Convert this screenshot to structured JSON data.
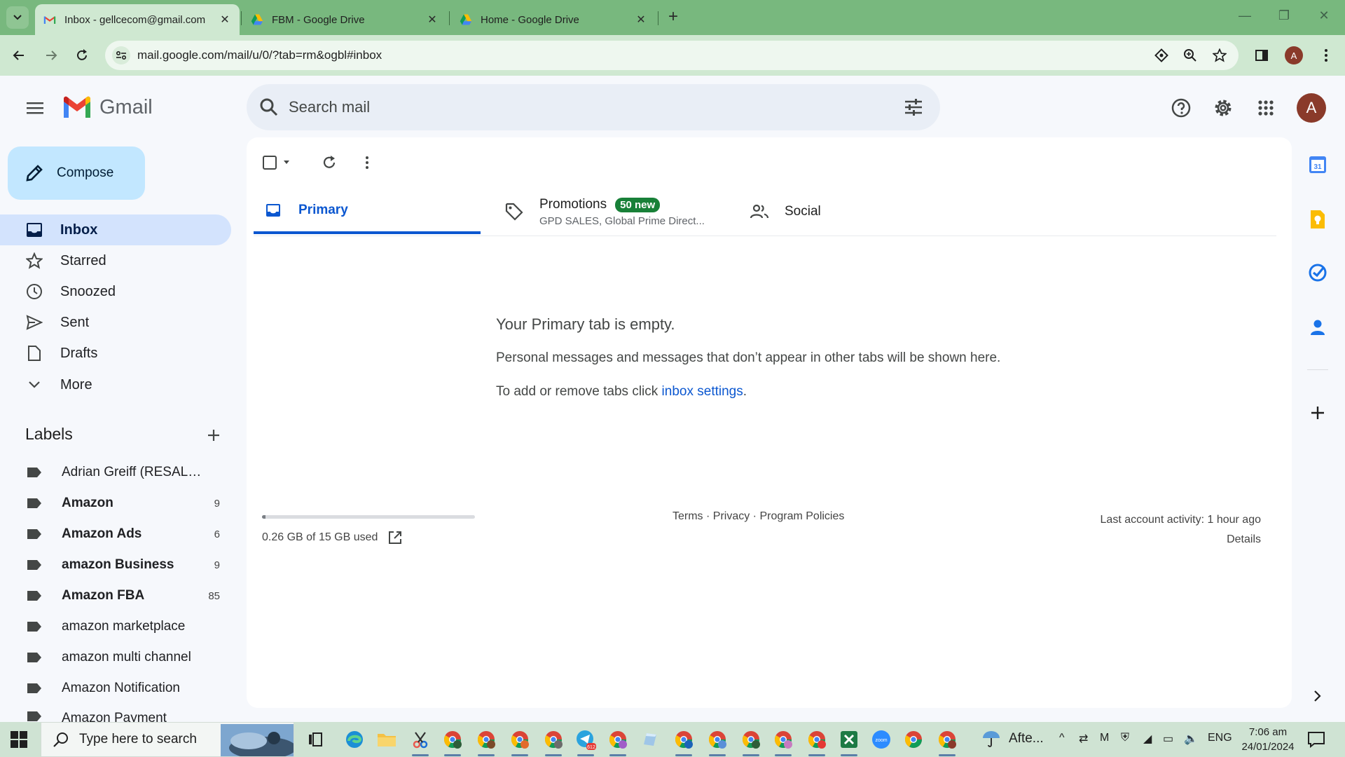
{
  "browser": {
    "tabs": [
      {
        "title": "Inbox - gellcecom@gmail.com",
        "active": true,
        "favicon": "gmail-icon"
      },
      {
        "title": "FBM - Google Drive",
        "active": false,
        "favicon": "drive-icon"
      },
      {
        "title": "Home - Google Drive",
        "active": false,
        "favicon": "drive-icon"
      }
    ],
    "url": "mail.google.com/mail/u/0/?tab=rm&ogbl#inbox",
    "profile_initial": "A"
  },
  "app": {
    "name": "Gmail",
    "search_placeholder": "Search mail",
    "avatar_initial": "A"
  },
  "compose_label": "Compose",
  "nav": [
    {
      "label": "Inbox",
      "icon": "inbox-icon",
      "active": true
    },
    {
      "label": "Starred",
      "icon": "star-icon"
    },
    {
      "label": "Snoozed",
      "icon": "clock-icon"
    },
    {
      "label": "Sent",
      "icon": "send-icon"
    },
    {
      "label": "Drafts",
      "icon": "draft-icon"
    },
    {
      "label": "More",
      "icon": "chevron-down-icon"
    }
  ],
  "labels_title": "Labels",
  "labels": [
    {
      "name": "Adrian Greiff (RESALE C...",
      "count": "",
      "bold": false
    },
    {
      "name": "Amazon",
      "count": "9",
      "bold": true
    },
    {
      "name": "Amazon Ads",
      "count": "6",
      "bold": true
    },
    {
      "name": "amazon Business",
      "count": "9",
      "bold": true
    },
    {
      "name": "Amazon FBA",
      "count": "85",
      "bold": true
    },
    {
      "name": "amazon marketplace",
      "count": "",
      "bold": false
    },
    {
      "name": "amazon multi channel",
      "count": "",
      "bold": false
    },
    {
      "name": "Amazon Notification",
      "count": "",
      "bold": false
    },
    {
      "name": "Amazon Payment",
      "count": "",
      "bold": false
    }
  ],
  "categories": {
    "primary": "Primary",
    "promotions": {
      "title": "Promotions",
      "badge": "50 new",
      "snippet": "GPD SALES, Global Prime Direct..."
    },
    "social": "Social"
  },
  "empty_state": {
    "title": "Your Primary tab is empty.",
    "line1": "Personal messages and messages that don’t appear in other tabs will be shown here.",
    "line2_prefix": "To add or remove tabs click ",
    "line2_link": "inbox settings",
    "line2_suffix": "."
  },
  "footer": {
    "storage_text": "0.26 GB of 15 GB used",
    "storage_fraction": 0.017,
    "links": "Terms · Privacy · Program Policies",
    "activity": "Last account activity: 1 hour ago",
    "details": "Details"
  },
  "taskbar": {
    "search_placeholder": "Type here to search",
    "weather": "Afte...",
    "language": "ENG",
    "time": "7:06 am",
    "date": "24/01/2024",
    "telegram_badge": "612"
  },
  "colors": {
    "tabstrip": "#78b87e",
    "toolbar": "#cfe8d1",
    "compose": "#c2e7ff",
    "active_nav": "#d3e3fd",
    "primary_accent": "#0b57d0",
    "badge_green": "#188038"
  }
}
